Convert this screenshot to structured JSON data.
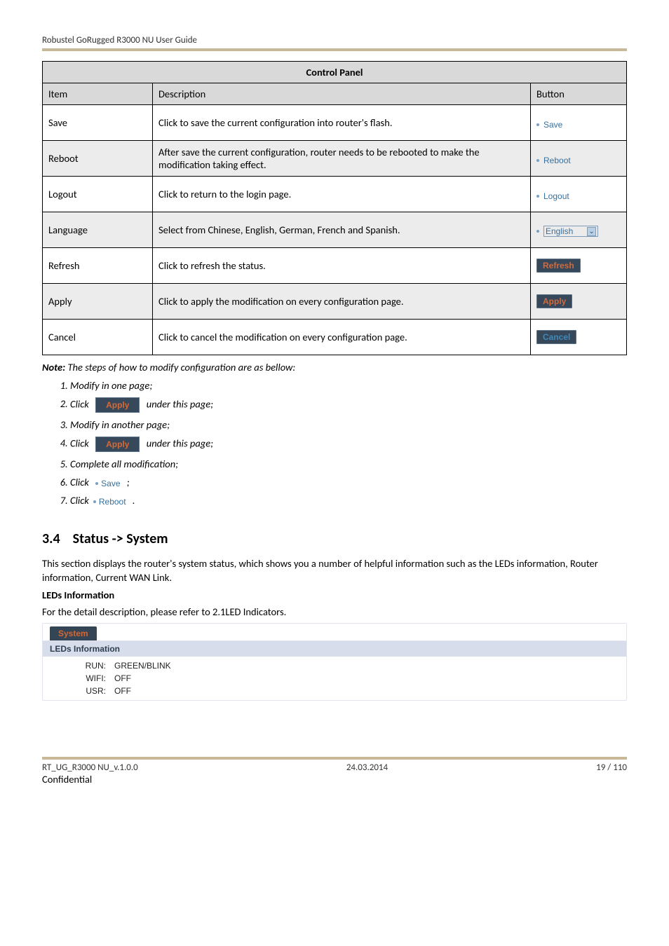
{
  "header": {
    "title": "Robustel GoRugged R3000 NU User Guide"
  },
  "table": {
    "title": "Control Panel",
    "headers": {
      "item": "Item",
      "desc": "Description",
      "button": "Button"
    },
    "rows": [
      {
        "item": "Save",
        "desc": "Click to save the current configuration into router's flash.",
        "btn_type": "link",
        "btn_label": "Save",
        "shade": false
      },
      {
        "item": "Reboot",
        "desc": "After save the current configuration, router needs to be rebooted to make the modification taking effect.",
        "btn_type": "link",
        "btn_label": "Reboot",
        "shade": true
      },
      {
        "item": "Logout",
        "desc": "Click to return to the login page.",
        "btn_type": "link",
        "btn_label": "Logout",
        "shade": false
      },
      {
        "item": "Language",
        "desc": "Select from Chinese, English, German, French and Spanish.",
        "btn_type": "select",
        "btn_label": "English",
        "shade": true
      },
      {
        "item": "Refresh",
        "desc": "Click to refresh the status.",
        "btn_type": "darkbtn",
        "btn_label": "Refresh",
        "btn_class": "refresh",
        "shade": false
      },
      {
        "item": "Apply",
        "desc": "Click to apply the modification on every configuration page.",
        "btn_type": "darkbtn",
        "btn_label": "Apply",
        "btn_class": "apply",
        "shade": true
      },
      {
        "item": "Cancel",
        "desc": "Click to cancel the modification on every configuration page.",
        "btn_type": "darkbtn",
        "btn_label": "Cancel",
        "btn_class": "cancel",
        "shade": false
      }
    ]
  },
  "note": {
    "label": "Note:",
    "text": " The steps of how to modify configuration are as bellow:",
    "steps": {
      "s1": "Modify in one page;",
      "s2_pre": "Click ",
      "s2_btn": "Apply",
      "s2_post": " under this page;",
      "s3": "Modify in another page;",
      "s4_pre": "Click ",
      "s4_btn": "Apply",
      "s4_post": " under this page;",
      "s5": "Complete all modification;",
      "s6_pre": "Click ",
      "s6_link": "Save",
      "s6_post": " ;",
      "s7_pre": "Click",
      "s7_link": "Reboot",
      "s7_post": " ."
    }
  },
  "section": {
    "num": "3.4",
    "title": "Status -> System",
    "para": "This section displays the router's system status, which shows you a number of helpful information such as the LEDs information, Router information, Current WAN Link.",
    "subhead": "LEDs Information",
    "subpara": "For the detail description, please refer to 2.1LED Indicators."
  },
  "panel": {
    "tab": "System",
    "leds_title": "LEDs Information",
    "rows": [
      {
        "label": "RUN:",
        "value": "GREEN/BLINK"
      },
      {
        "label": "WIFI:",
        "value": "OFF"
      },
      {
        "label": "USR:",
        "value": "OFF"
      }
    ]
  },
  "footer": {
    "left1": "RT_UG_R3000 NU_v.1.0.0",
    "left2": "Confidential",
    "center": "24.03.2014",
    "right": "19 / 110"
  }
}
